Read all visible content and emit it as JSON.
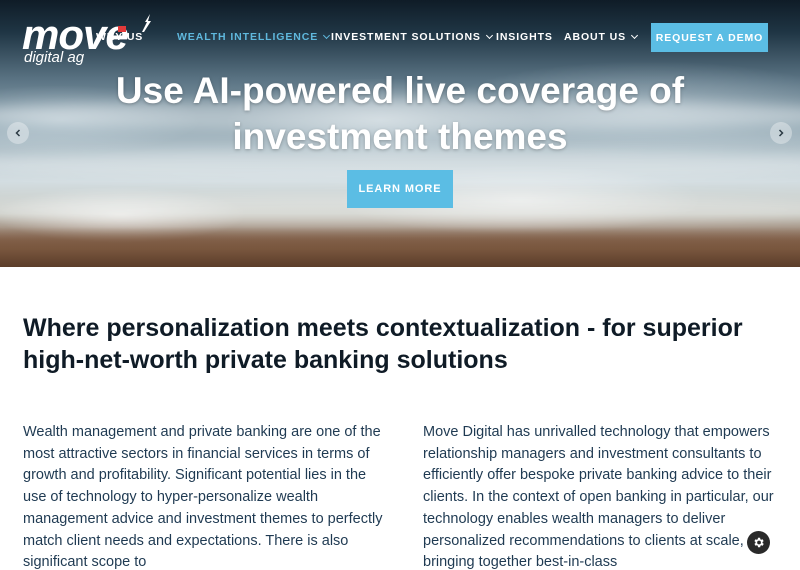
{
  "brand": {
    "logo_word": "move",
    "logo_sub": "digital ag"
  },
  "nav": {
    "items": [
      {
        "label": "Why Us",
        "active": false,
        "has_dropdown": false
      },
      {
        "label": "Wealth Intelligence",
        "active": true,
        "has_dropdown": true
      },
      {
        "label": "Investment Solutions",
        "active": false,
        "has_dropdown": true
      },
      {
        "label": "Insights",
        "active": false,
        "has_dropdown": false
      },
      {
        "label": "About Us",
        "active": false,
        "has_dropdown": true
      }
    ],
    "cta_label": "Request a Demo"
  },
  "hero": {
    "title": "Use AI-powered live coverage of investment themes",
    "button_label": "Learn More",
    "prev_icon": "chevron-left-icon",
    "next_icon": "chevron-right-icon"
  },
  "content": {
    "heading": "Where personalization meets contextualization - for superior high-net-worth private banking solutions",
    "col1": "Wealth management and private banking are one of the most attractive sectors in financial services in terms of growth and profitability. Significant potential lies in the use of technology to hyper-personalize wealth management advice and investment themes to perfectly match client needs and expectations. There is also significant scope to",
    "col2": "Move Digital has unrivalled technology that empowers relationship managers and investment consultants to efficiently offer bespoke private banking advice to their clients. In the context of open banking in particular, our technology enables wealth managers to deliver personalized recommendations to clients at scale, bringing together best-in-class"
  },
  "widgets": {
    "settings_icon": "gear-icon"
  },
  "colors": {
    "accent": "#5bbde4",
    "nav_active": "#5fb8dd",
    "heading": "#0f1b26",
    "body_text": "#1f3a52"
  }
}
